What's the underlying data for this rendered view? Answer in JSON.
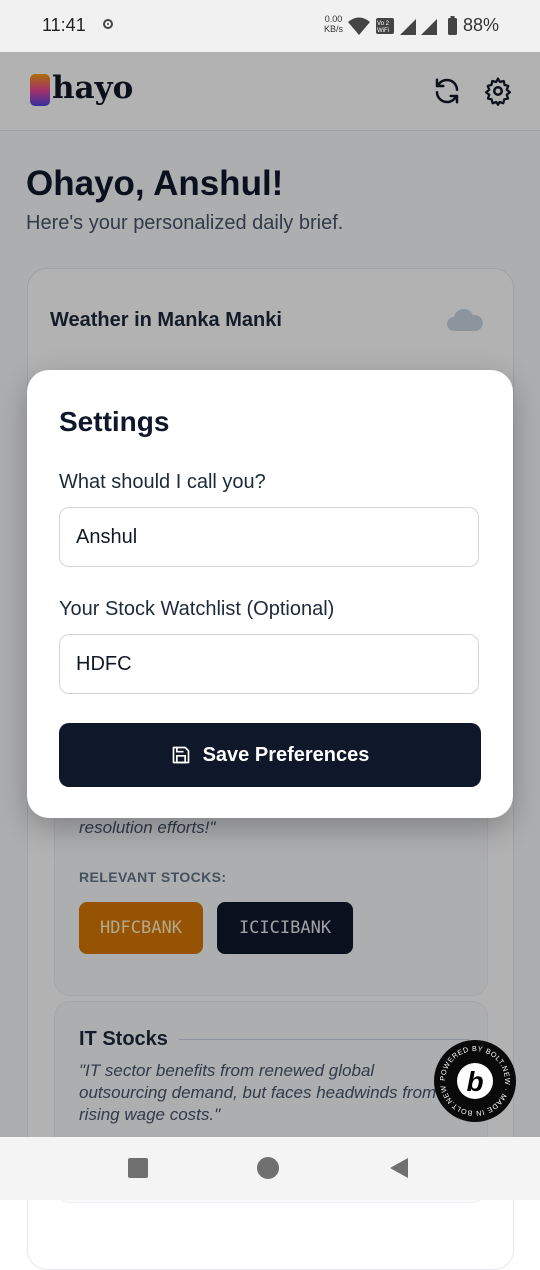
{
  "status_bar": {
    "time": "11:41",
    "network_speed_value": "0.00",
    "network_speed_unit": "KB/s",
    "battery": "88%",
    "icons": [
      "wifi-icon",
      "vowifi-icon",
      "signal-icon",
      "signal-icon",
      "battery-icon"
    ]
  },
  "app": {
    "logo_text": "hayo",
    "header_icons": [
      "refresh-icon",
      "gear-icon"
    ],
    "greeting": "Ohayo, Anshul!",
    "subtitle": "Here's your personalized daily brief.",
    "weather": {
      "title": "Weather in Manka Manki",
      "icon": "cloud-icon"
    },
    "news_card": {
      "quote_tail": "resolution efforts!\"",
      "relevant_label": "RELEVANT STOCKS:",
      "stocks": [
        "HDFCBANK",
        "ICICIBANK"
      ]
    },
    "it_card": {
      "title": "IT Stocks",
      "quote": "\"IT sector benefits from renewed global outsourcing demand, but faces headwinds from rising wage costs.\""
    }
  },
  "modal": {
    "title": "Settings",
    "name_label": "What should I call you?",
    "name_value": "Anshul",
    "watchlist_label": "Your Stock Watchlist (Optional)",
    "watchlist_value": "HDFC",
    "save_label": "Save Preferences",
    "save_icon": "save-icon"
  },
  "badge": {
    "ring_text": "POWERED BY BOLT.NEW · MADE IN BOLT.NEW ·",
    "glyph": "b"
  },
  "nav": {
    "buttons": [
      "recents-button",
      "home-button",
      "back-button"
    ]
  },
  "colors": {
    "primary": "#0f172a",
    "accent_orange": "#d97706",
    "overlay": "rgba(0,0,0,0.30)"
  }
}
